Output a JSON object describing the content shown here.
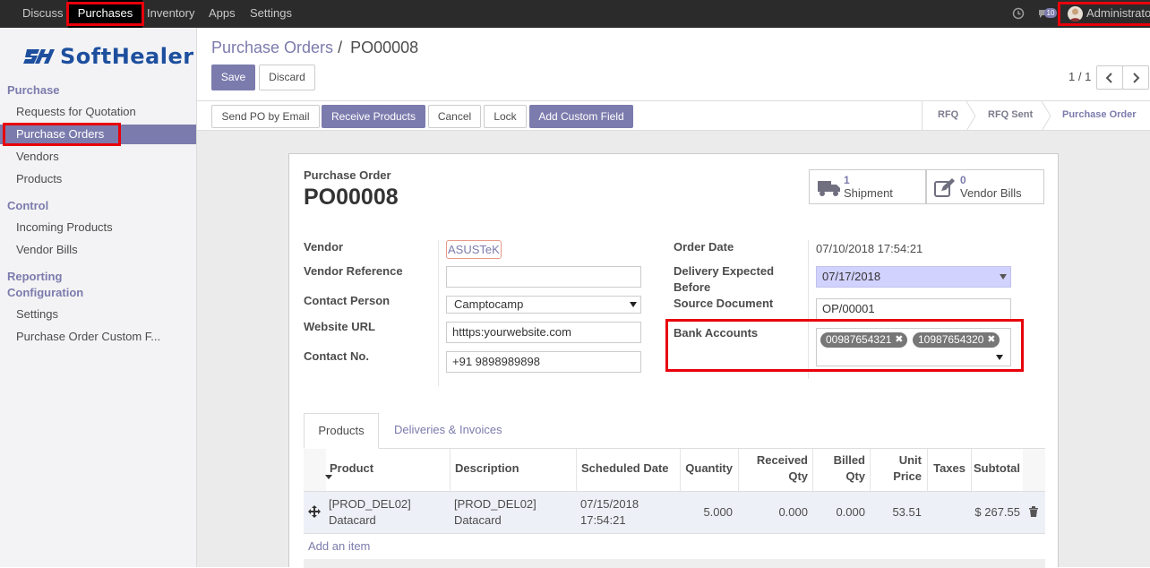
{
  "topnav": {
    "items": [
      "Discuss",
      "Purchases",
      "Inventory",
      "Apps",
      "Settings"
    ],
    "message_count": "10",
    "user": "Administrator"
  },
  "brand": {
    "logo_text": "SoftHealer"
  },
  "sidebar": {
    "sections": [
      {
        "title": "Purchase",
        "items": [
          "Requests for Quotation",
          "Purchase Orders",
          "Vendors",
          "Products"
        ]
      },
      {
        "title": "Control",
        "items": [
          "Incoming Products",
          "Vendor Bills"
        ]
      },
      {
        "title": "Reporting",
        "items": []
      },
      {
        "title": "Configuration",
        "items": [
          "Settings",
          "Purchase Order Custom F..."
        ]
      }
    ]
  },
  "header": {
    "breadcrumb_parent": "Purchase Orders",
    "breadcrumb_sep": "/",
    "breadcrumb_current": "PO00008",
    "save": "Save",
    "discard": "Discard",
    "pager": "1 / 1"
  },
  "actions": [
    "Send PO by Email",
    "Receive Products",
    "Cancel",
    "Lock",
    "Add Custom Field"
  ],
  "statusbar": [
    "RFQ",
    "RFQ Sent",
    "Purchase Order"
  ],
  "smart_buttons": [
    {
      "count": "1",
      "label": "Shipment",
      "icon": "truck-icon"
    },
    {
      "count": "0",
      "label": "Vendor Bills",
      "icon": "pencil-square-icon"
    }
  ],
  "form": {
    "title_label": "Purchase Order",
    "name": "PO00008",
    "labels": {
      "vendor": "Vendor",
      "vendor_ref": "Vendor Reference",
      "contact_person": "Contact Person",
      "website": "Website URL",
      "contact_no": "Contact No.",
      "order_date": "Order Date",
      "delivery_expected_1": "Delivery Expected",
      "delivery_expected_2": "Before",
      "source_doc": "Source Document",
      "bank_accounts": "Bank Accounts"
    },
    "values": {
      "vendor": "ASUSTeK",
      "vendor_ref": "",
      "contact_person": "Camptocamp",
      "website": "htttps:yourwebsite.com",
      "contact_no": "+91 9898989898",
      "order_date": "07/10/2018 17:54:21",
      "delivery_expected": "07/17/2018",
      "source_doc": "OP/00001",
      "bank_accounts": [
        "00987654321",
        "10987654320"
      ]
    }
  },
  "tabs": [
    "Products",
    "Deliveries & Invoices"
  ],
  "table": {
    "headers": {
      "product": "Product",
      "description": "Description",
      "scheduled": "Scheduled Date",
      "quantity": "Quantity",
      "received_1": "Received",
      "received_2": "Qty",
      "billed_1": "Billed",
      "billed_2": "Qty",
      "unit_1": "Unit",
      "unit_2": "Price",
      "taxes": "Taxes",
      "subtotal": "Subtotal"
    },
    "rows": [
      {
        "product_1": "[PROD_DEL02]",
        "product_2": "Datacard",
        "desc_1": "[PROD_DEL02]",
        "desc_2": "Datacard",
        "date_1": "07/15/2018",
        "date_2": "17:54:21",
        "quantity": "5.000",
        "received": "0.000",
        "billed": "0.000",
        "unit_price": "53.51",
        "taxes": "",
        "subtotal": "$ 267.55"
      }
    ],
    "add_item": "Add an item"
  }
}
